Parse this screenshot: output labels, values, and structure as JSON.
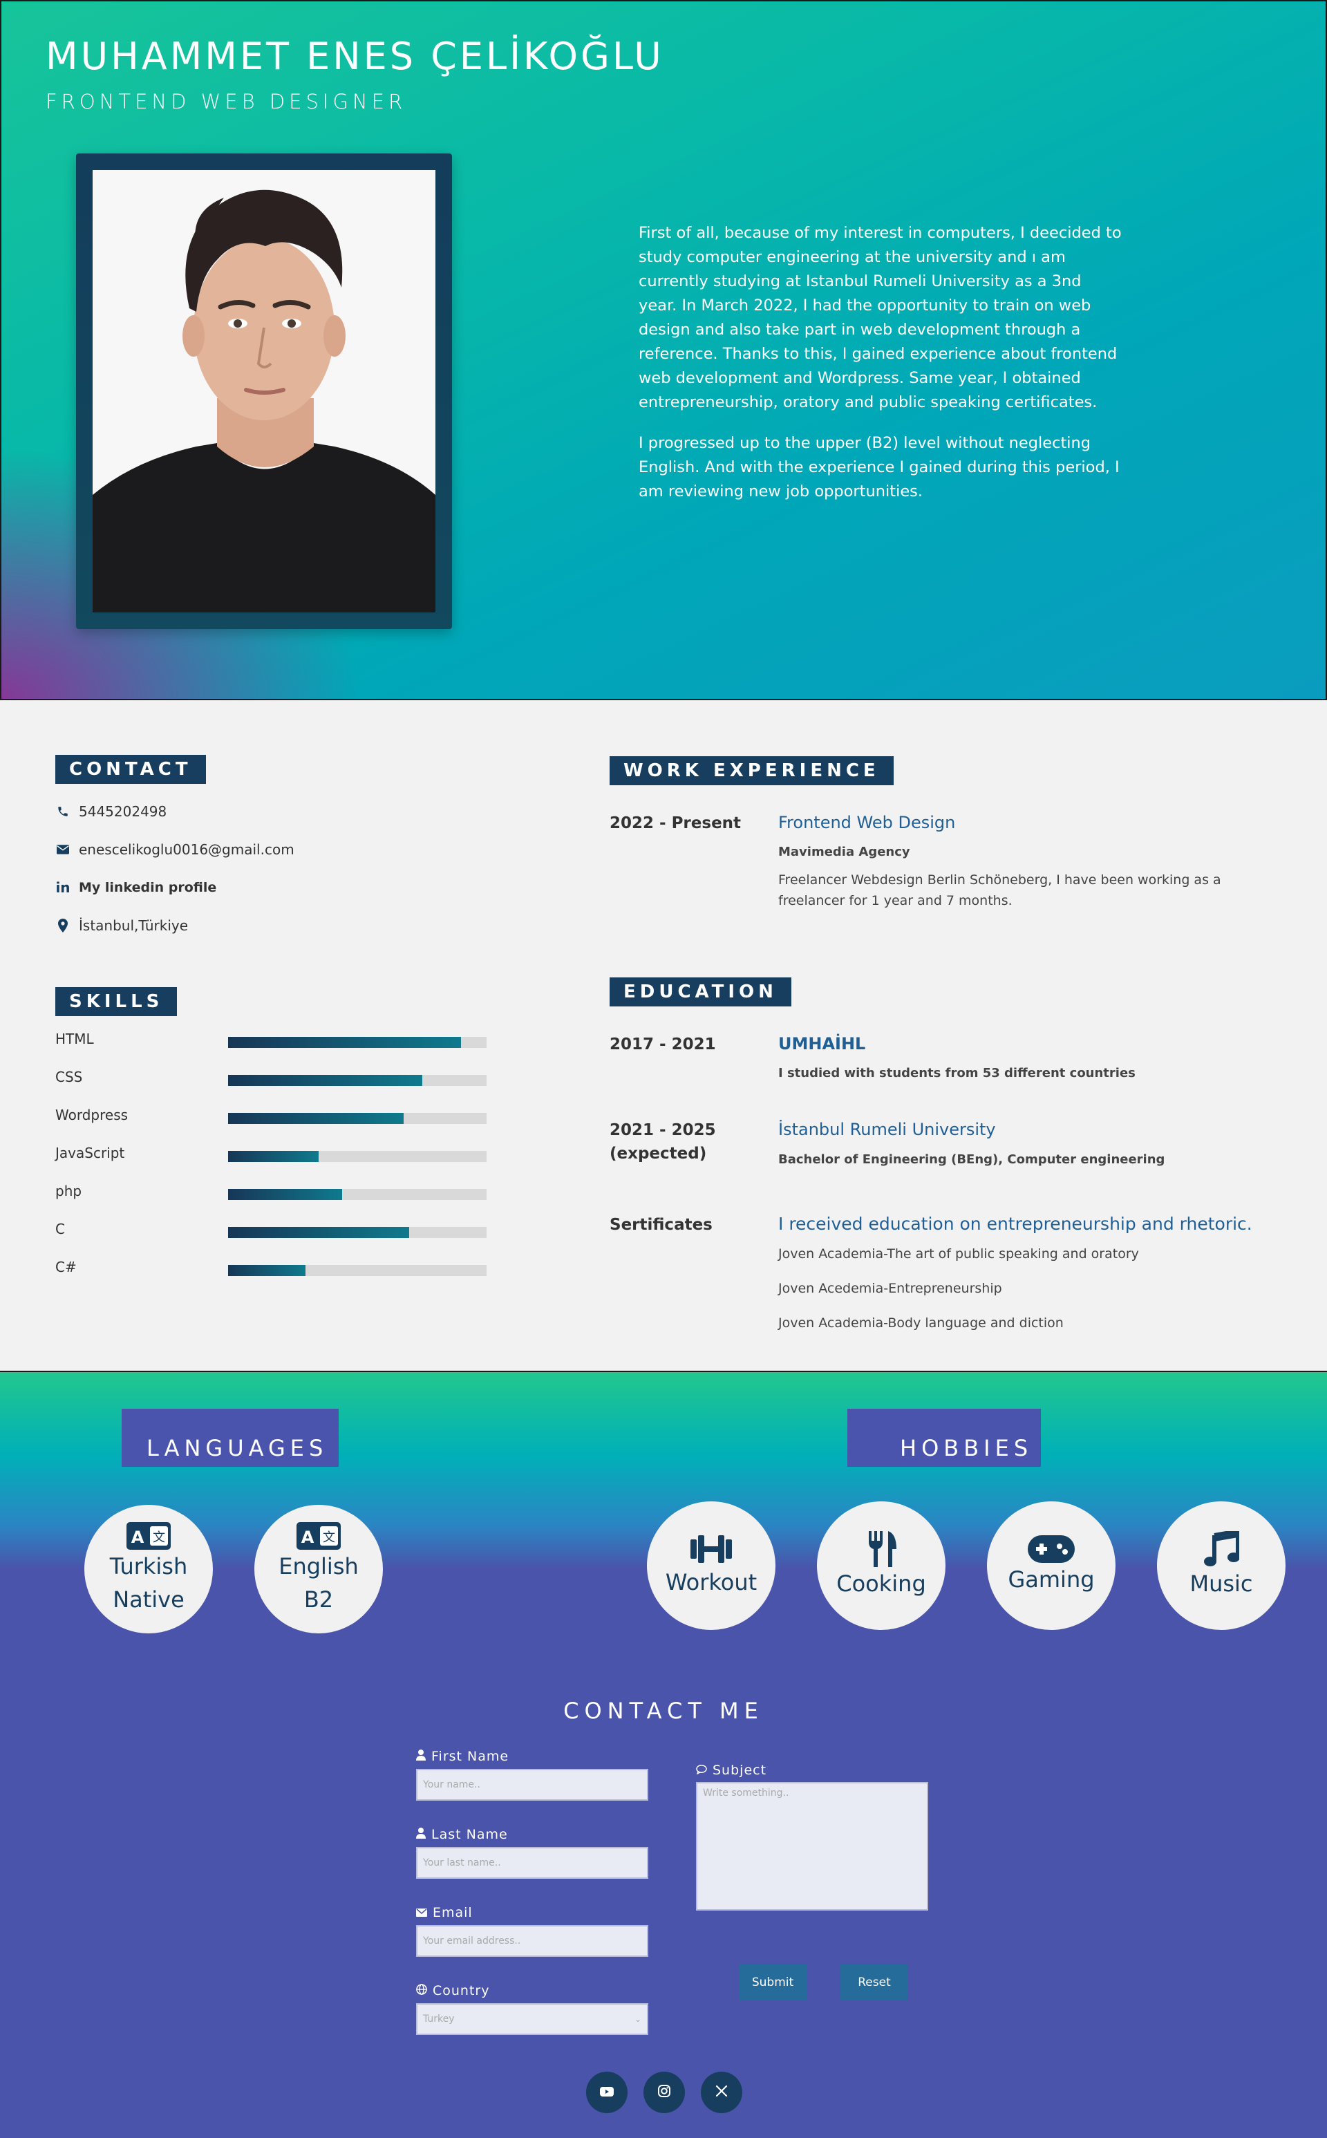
{
  "hero": {
    "name": "MUHAMMET ENES ÇELİKOĞLU",
    "role": "FRONTEND WEB DESIGNER",
    "bio": [
      "First of all, because of my interest in computers, I deecided to study computer engineering at the university and ı am currently studying at Istanbul Rumeli University as a 3nd year. In March 2022, I had the opportunity to train on web design and also take part in web development through a reference. Thanks to this, I gained experience about frontend web development and Wordpress. Same year, I obtained entrepreneurship, oratory and public speaking certificates.",
      "I progressed up to the upper (B2) level without neglecting English. And with the experience I gained during this period, I am reviewing new job opportunities."
    ]
  },
  "contact": {
    "title": "CONTACT",
    "phone": "5445202498",
    "email": "enescelikoglu0016@gmail.com",
    "linkedin": "My linkedin profile",
    "location": "İstanbul,Türkiye"
  },
  "skills": {
    "title": "SKILLS",
    "items": [
      {
        "name": "HTML",
        "level": 0.9
      },
      {
        "name": "CSS",
        "level": 0.75
      },
      {
        "name": "Wordpress",
        "level": 0.68
      },
      {
        "name": "JavaScript",
        "level": 0.35
      },
      {
        "name": "php",
        "level": 0.44
      },
      {
        "name": "C",
        "level": 0.7
      },
      {
        "name": "C#",
        "level": 0.3
      }
    ]
  },
  "work": {
    "title": "WORK EXPERIENCE",
    "period": "2022 - Present",
    "position": "Frontend Web Design",
    "company": "Mavimedia Agency",
    "description": "Freelancer Webdesign Berlin Schöneberg, I have been working as a freelancer for 1 year and 7 months."
  },
  "education": {
    "title": "EDUCATION",
    "entries": [
      {
        "period": "2017 - 2021",
        "school": "UMHAİHL",
        "detail": "I studied with students from 53 different countries"
      },
      {
        "period": "2021 - 2025 (expected)",
        "school": "İstanbul Rumeli University",
        "detail": "Bachelor of Engineering (BEng), Computer engineering"
      }
    ],
    "certificates": {
      "label": "Sertificates",
      "heading": "I received education on entrepreneurship and rhetoric.",
      "items": [
        "Joven Academia-The art of public speaking and oratory",
        "Joven Acedemia-Entrepreneurship",
        "Joven Academia-Body language and diction"
      ]
    }
  },
  "languages": {
    "title": "LANGUAGES",
    "items": [
      {
        "name": "Turkish",
        "level": "Native"
      },
      {
        "name": "English",
        "level": "B2"
      }
    ]
  },
  "hobbies": {
    "title": "HOBBIES",
    "items": [
      "Workout",
      "Cooking",
      "Gaming",
      "Music"
    ]
  },
  "contact_form": {
    "title": "CONTACT ME",
    "first_name_label": "First Name",
    "first_name_placeholder": "Your name..",
    "last_name_label": "Last Name",
    "last_name_placeholder": "Your last name..",
    "email_label": "Email",
    "email_placeholder": "Your email address..",
    "country_label": "Country",
    "country_value": "Turkey",
    "subject_label": "Subject",
    "subject_placeholder": "Write something..",
    "submit": "Submit",
    "reset": "Reset"
  },
  "social": [
    "youtube-icon",
    "instagram-icon",
    "x-icon"
  ]
}
